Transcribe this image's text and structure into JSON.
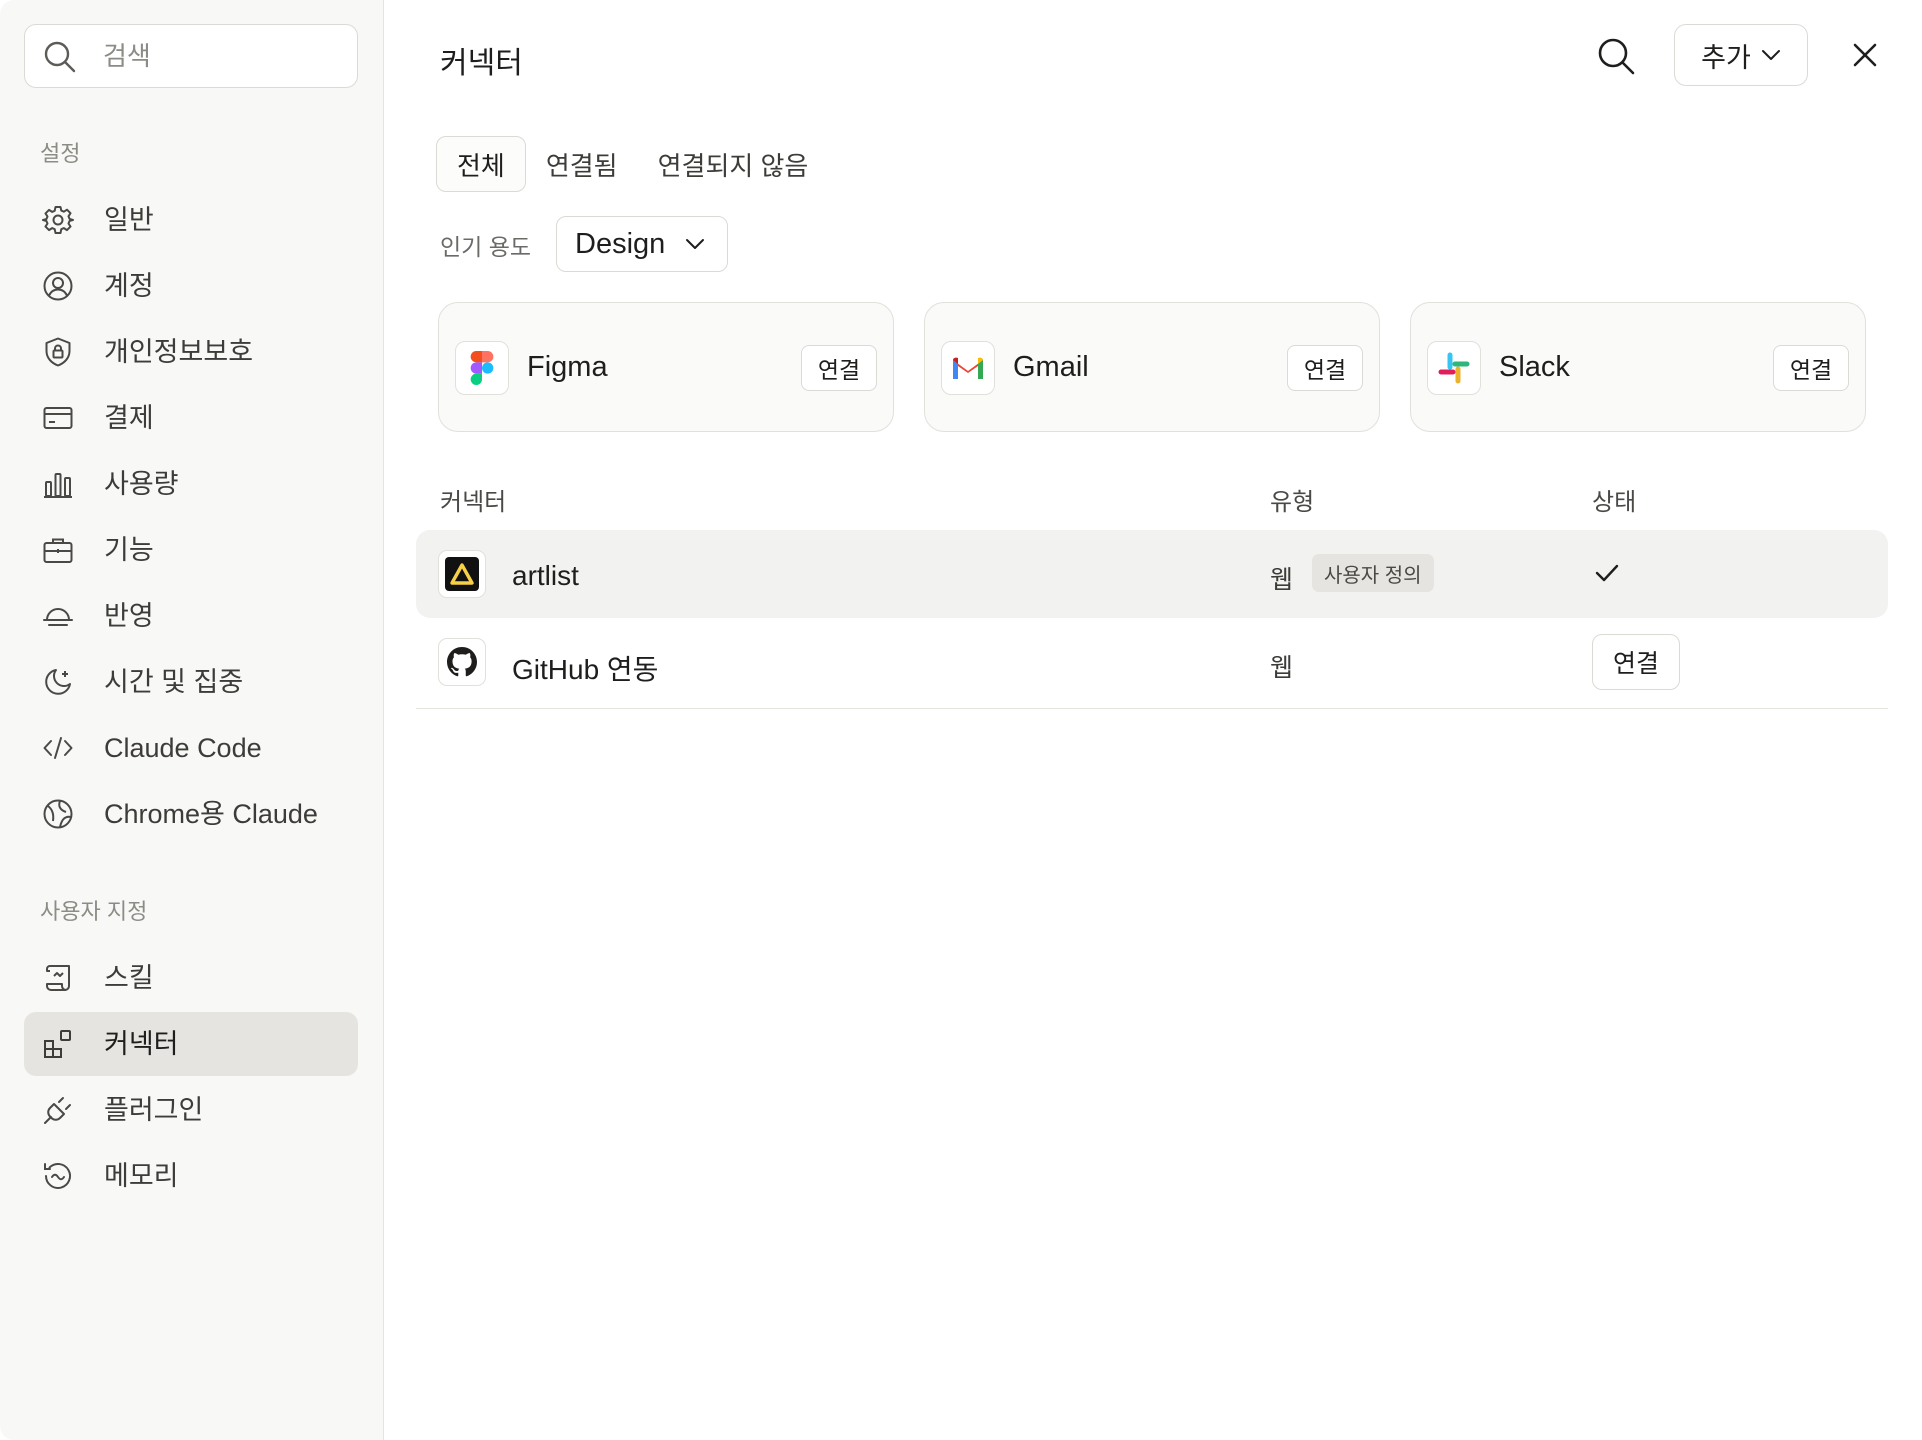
{
  "sidebar": {
    "search": {
      "placeholder": "검색"
    },
    "section_settings": "설정",
    "settings_items": [
      {
        "label": "일반",
        "icon": "gear-icon"
      },
      {
        "label": "계정",
        "icon": "user-circle-icon"
      },
      {
        "label": "개인정보보호",
        "icon": "shield-lock-icon"
      },
      {
        "label": "결제",
        "icon": "credit-card-icon"
      },
      {
        "label": "사용량",
        "icon": "bar-chart-icon"
      },
      {
        "label": "기능",
        "icon": "briefcase-icon"
      },
      {
        "label": "반영",
        "icon": "sunset-icon"
      },
      {
        "label": "시간 및 집중",
        "icon": "moon-star-icon"
      },
      {
        "label": "Claude Code",
        "icon": "code-icon"
      },
      {
        "label": "Chrome용 Claude",
        "icon": "globe-icon"
      }
    ],
    "section_custom": "사용자 지정",
    "custom_items": [
      {
        "label": "스킬",
        "icon": "scroll-icon"
      },
      {
        "label": "커넥터",
        "icon": "connector-blocks-icon",
        "active": true
      },
      {
        "label": "플러그인",
        "icon": "plug-icon"
      },
      {
        "label": "메모리",
        "icon": "memory-history-icon"
      }
    ]
  },
  "header": {
    "title": "커넥터",
    "add_label": "추가"
  },
  "tabs": [
    {
      "label": "전체",
      "active": true
    },
    {
      "label": "연결됨",
      "active": false
    },
    {
      "label": "연결되지 않음",
      "active": false
    }
  ],
  "popular": {
    "label": "인기 용도",
    "selected": "Design"
  },
  "featured": [
    {
      "name": "Figma",
      "button": "연결",
      "icon": "figma-logo-icon"
    },
    {
      "name": "Gmail",
      "button": "연결",
      "icon": "gmail-logo-icon"
    },
    {
      "name": "Slack",
      "button": "연결",
      "icon": "slack-logo-icon"
    }
  ],
  "table": {
    "headers": {
      "connector": "커넥터",
      "type": "유형",
      "status": "상태"
    },
    "rows": [
      {
        "name": "artlist",
        "type": "웹",
        "badge": "사용자 정의",
        "status": "connected",
        "icon": "artlist-logo-icon"
      },
      {
        "name": "GitHub 연동",
        "type": "웹",
        "button": "연결",
        "status": "not-connected",
        "icon": "github-logo-icon"
      }
    ]
  },
  "colors": {
    "sidebar_bg": "#f8f8f6",
    "active_item_bg": "#e5e4e1",
    "highlight_row_bg": "#f2f2f0",
    "text_primary": "#1f1e1d",
    "text_muted": "#8d8b86"
  }
}
